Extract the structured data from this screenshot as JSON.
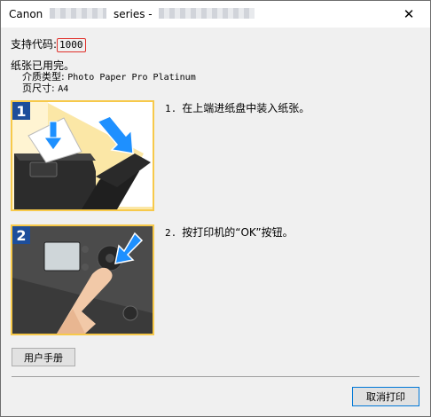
{
  "window": {
    "title_prefix": "Canon",
    "title_mid": "series -",
    "close_glyph": "✕"
  },
  "support": {
    "label": "支持代码:",
    "code": "1000"
  },
  "message": {
    "main": "纸张已用完。",
    "media_type_label": "介质类型:",
    "media_type_value": "Photo Paper Pro Platinum",
    "page_size_label": "页尺寸:",
    "page_size_value": "A4"
  },
  "steps": [
    {
      "badge": "1",
      "num": "1.",
      "text": "在上端进纸盘中装入纸张。"
    },
    {
      "badge": "2",
      "num": "2.",
      "text": "按打印机的“OK”按钮。"
    }
  ],
  "buttons": {
    "manual": "用户手册",
    "cancel": "取消打印"
  },
  "colors": {
    "error_box": "#e0302a",
    "step_frame": "#f7c94a",
    "arrow": "#1e90ff"
  },
  "icons": {
    "close": "close-icon",
    "step1_arrows": "arrow-down-icon",
    "step2_arrow": "arrow-down-left-icon"
  }
}
